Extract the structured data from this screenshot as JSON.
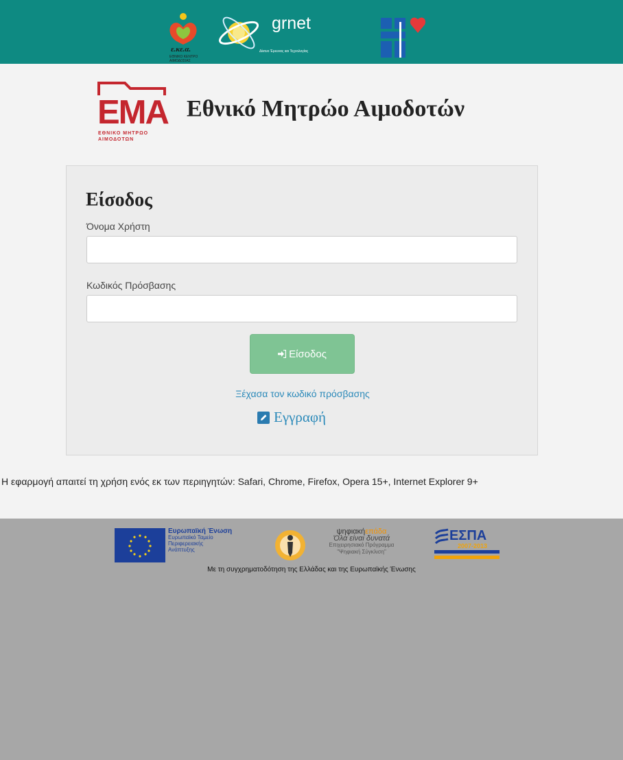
{
  "header": {
    "logo_ekea_text": "ε.κε.α.",
    "logo_ekea_sub": "ΕΘΝΙΚΟ ΚΕΝΤΡΟ ΑΙΜΟΔΟΣΙΑΣ",
    "logo_grnet_text": "grnet",
    "logo_grnet_sub": "Δίκτυο Έρευνας και Τεχνολογίας",
    "background_color": "#0e8a82"
  },
  "brand": {
    "ema_logo_text": "ΕΜΑ",
    "ema_logo_sub1": "ΕΘΝΙΚΟ ΜΗΤΡΩΟ",
    "ema_logo_sub2": "ΑΙΜΟΔΟΤΩΝ",
    "page_title": "Εθνικό Μητρώο Αιμοδοτών"
  },
  "login": {
    "heading": "Είσοδος",
    "username_label": "Όνομα Χρήστη",
    "username_value": "",
    "password_label": "Κωδικός Πρόσβασης",
    "password_value": "",
    "submit_label": "Είσοδος",
    "forgot_link": "Ξέχασα τον κωδικό πρόσβασης",
    "register_link": "Εγγραφή",
    "button_color": "#7fc494",
    "link_color": "#2a89b9"
  },
  "browser_note": "Η εφαρμογή απαιτεί τη χρήση ενός εκ των περιηγητών: Safari, Chrome, Firefox, Opera 15+, Internet Explorer 9+",
  "footer": {
    "eu_line1": "Ευρωπαϊκή Ένωση",
    "eu_line2": "Ευρωπαϊκό Ταμείο",
    "eu_line3": "Περιφερειακής",
    "eu_line4": "Ανάπτυξης",
    "digital_line1_a": "ψηφιακή",
    "digital_line1_b": "επάδα",
    "digital_line2": "Όλα είναι δυνατά",
    "digital_line3": "Επιχειρησιακό Πρόγραμμα",
    "digital_line4": "\"Ψηφιακή Σύγκλιση\"",
    "espa_text": "ΕΣΠΑ",
    "espa_years": "2007-2013",
    "caption": "Με τη συγχρηματοδότηση της Ελλάδας και της Ευρωπαϊκής Ένωσης",
    "background_color": "#a7a7a7"
  }
}
